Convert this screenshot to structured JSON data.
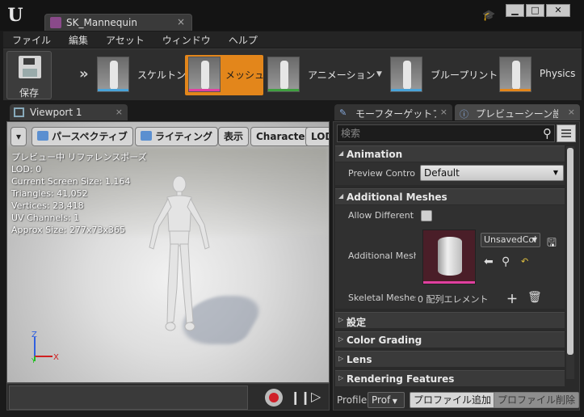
{
  "window": {
    "doc_tab_title": "SK_Mannequin",
    "close_glyph": "×",
    "controls": {
      "minimize": "▁",
      "maximize": "□",
      "close": "✕"
    }
  },
  "menu": [
    "ファイル",
    "編集",
    "アセット",
    "ウィンドウ",
    "ヘルプ"
  ],
  "toolbar": {
    "save_label": "保存",
    "modes": [
      {
        "label": "スケルトン",
        "color": "#4aa3d8",
        "active": false
      },
      {
        "label": "メッシュ",
        "color": "#e040a0",
        "active": true
      },
      {
        "label": "アニメーション",
        "color": "#3fa040",
        "active": false
      },
      {
        "label": "ブループリント",
        "color": "#4aa3d8",
        "active": false
      },
      {
        "label": "Physics",
        "color": "#e3861b",
        "active": false
      }
    ],
    "accent_color": "#e3861b"
  },
  "viewport": {
    "tab_label": "Viewport 1",
    "buttons": {
      "perspective": "パースペクティブ",
      "lighting": "ライティング",
      "show": "表示",
      "character": "Character",
      "lod": "LOD"
    },
    "stats": [
      "プレビュー中 リファレンスポーズ",
      "LOD: 0",
      "Current Screen Size: 1.164",
      "Triangles: 41,052",
      "Vertices: 23,418",
      "UV Channels: 1",
      "Approx Size: 277x73x365"
    ],
    "axes": {
      "z": "Z",
      "x": "X",
      "y": "Y"
    }
  },
  "right_panel": {
    "tabs": [
      {
        "label": "モーフターゲットプレ",
        "active": false
      },
      {
        "label": "プレビューシーン設",
        "active": true
      }
    ],
    "search_placeholder": "検索",
    "categories": {
      "animation": "Animation",
      "additional_meshes": "Additional Meshes",
      "settings": "設定",
      "color_grading": "Color Grading",
      "lens": "Lens",
      "rendering_features": "Rendering Features"
    },
    "properties": {
      "preview_controller_label": "Preview Controll",
      "preview_controller_value": "Default",
      "allow_different_label": "Allow Different S",
      "additional_mesh_label": "Additional Mesh",
      "additional_mesh_asset": "UnsavedCol",
      "skeletal_meshes_label": "Skeletal Meshes",
      "skeletal_meshes_value": "0 配列エレメント"
    },
    "profile": {
      "label": "Profile",
      "combo": "Prof",
      "add_button": "プロファイル追加",
      "remove_button": "プロファイル削除"
    }
  }
}
